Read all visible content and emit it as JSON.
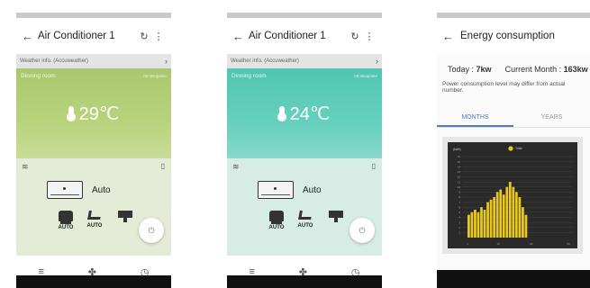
{
  "screens": [
    {
      "title": "Air Conditioner 1",
      "refresh_icon": "refresh-icon",
      "weather_info": "Weather info. (Accuweather)",
      "room_name": "Dinning room",
      "updated": "09:36Update",
      "temperature": "29℃",
      "mode": "Auto",
      "fan_label": "AUTO",
      "swing_label": "AUTO",
      "theme_color": "#a9c86d"
    },
    {
      "title": "Air Conditioner 1",
      "refresh_icon": "refresh-icon",
      "weather_info": "Weather info. (Accuweather)",
      "room_name": "Dinning room",
      "updated": "09:36Update",
      "temperature": "24℃",
      "mode": "Auto",
      "fan_label": "AUTO",
      "swing_label": "AUTO",
      "theme_color": "#4fc6b0"
    }
  ],
  "energy": {
    "title": "Energy consumption",
    "today_label": "Today :",
    "today_value": "7kw",
    "month_label": "Current Month :",
    "month_value": "163kw",
    "note": "Power consumption level may differ from actual number.",
    "tabs": [
      "MONTHS",
      "YEARS"
    ],
    "active_tab": "MONTHS"
  },
  "chart_data": {
    "type": "bar",
    "ylabel": "(kwh)",
    "legend": "Total",
    "bar_color": "#e9c81e",
    "x_ticks": [
      "1",
      "10",
      "20",
      "30"
    ],
    "y_ticks": [
      "16",
      "15",
      "14",
      "13",
      "12",
      "11",
      "10",
      "9",
      "8",
      "7",
      "6",
      "5",
      "4",
      "3",
      "2",
      "1"
    ],
    "ylim": [
      0,
      16
    ],
    "values": [
      4.5,
      5,
      5.5,
      5,
      6,
      5.5,
      7,
      7.5,
      8,
      9,
      9.5,
      8.5,
      10,
      11,
      10,
      9,
      8,
      6,
      4.5
    ]
  }
}
